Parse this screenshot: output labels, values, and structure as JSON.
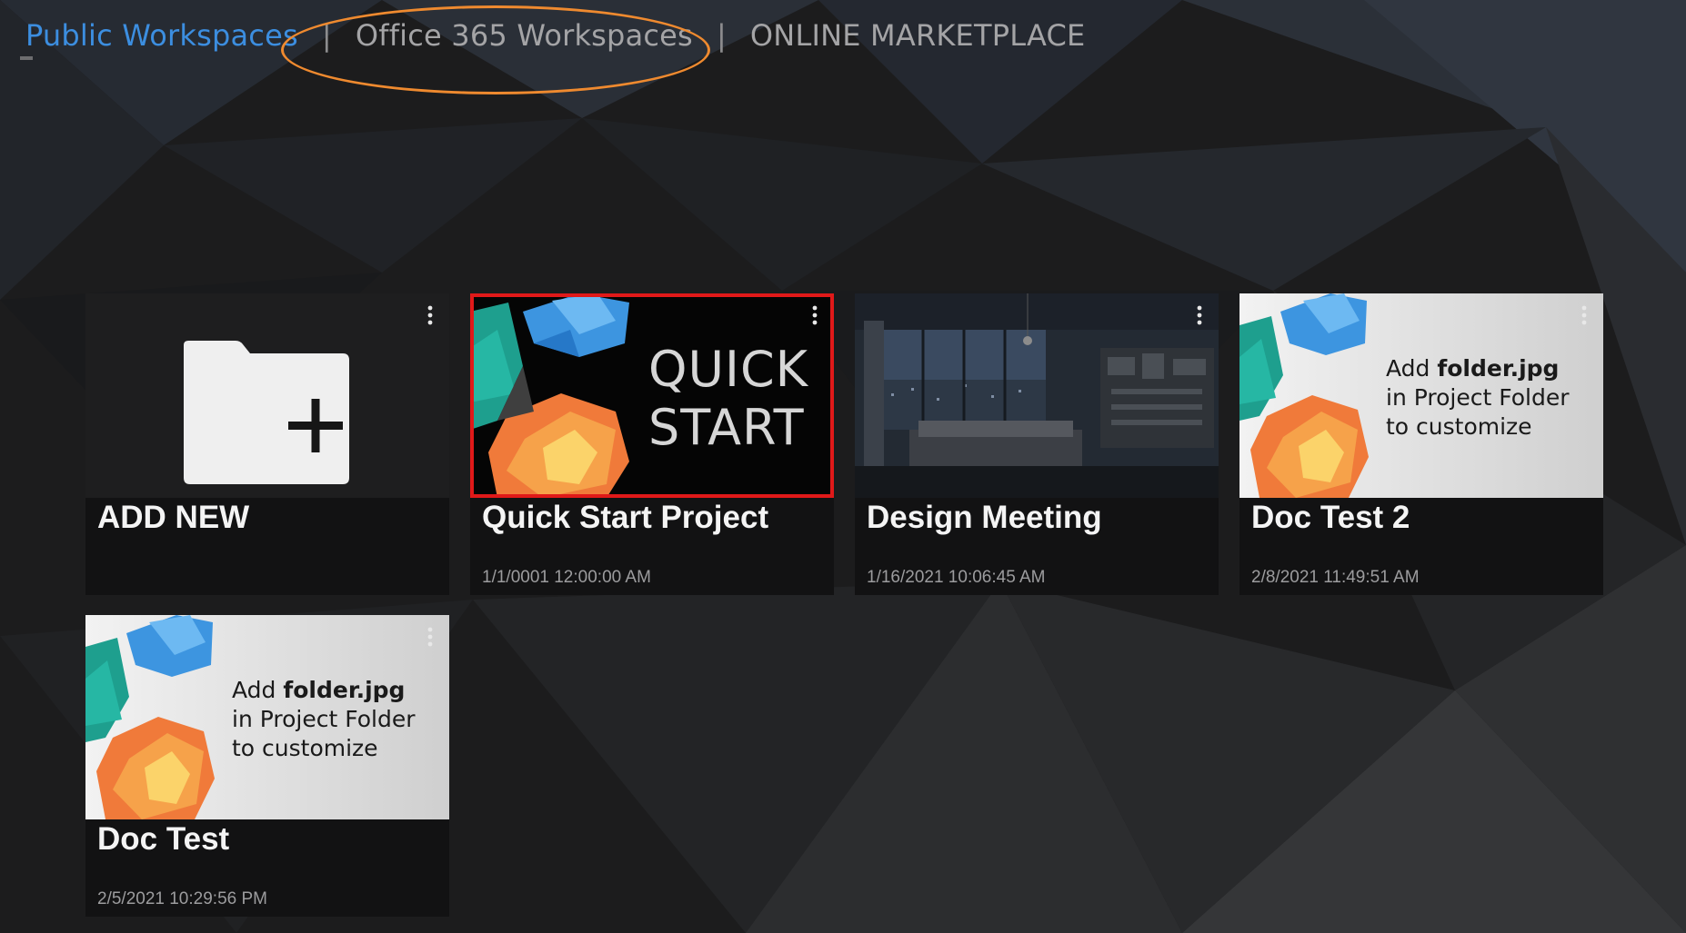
{
  "nav": {
    "tabs": [
      {
        "label": "Public Workspaces",
        "active": true
      },
      {
        "label": "Office 365 Workspaces",
        "active": false
      },
      {
        "label": "ONLINE MARKETPLACE",
        "active": false
      }
    ],
    "separator": "|"
  },
  "cards": [
    {
      "title": "ADD NEW",
      "date": "",
      "thumbnail": "folder-plus-icon"
    },
    {
      "title": "Quick Start Project",
      "date": "1/1/0001 12:00:00 AM",
      "thumbnail_line1": "QUICK",
      "thumbnail_line2": "START",
      "selected": true
    },
    {
      "title": "Design Meeting",
      "date": "1/16/2021 10:06:45 AM",
      "thumbnail": "room-photo"
    },
    {
      "title": "Doc Test 2",
      "date": "2/8/2021 11:49:51 AM",
      "thumbnail_text": {
        "prefix": "Add ",
        "bold": "folder.jpg",
        "line2": "in Project Folder",
        "line3": "to customize"
      }
    },
    {
      "title": "Doc Test",
      "date": "2/5/2021 10:29:56 PM",
      "thumbnail_text": {
        "prefix": "Add ",
        "bold": "folder.jpg",
        "line2": "in Project Folder",
        "line3": "to customize"
      }
    }
  ],
  "colors": {
    "active_tab": "#3c8ee0",
    "inactive_tab": "#a4a4a6",
    "highlight_ring": "#ef8a2f",
    "selection": "#e01919",
    "card_bg": "#121213"
  }
}
